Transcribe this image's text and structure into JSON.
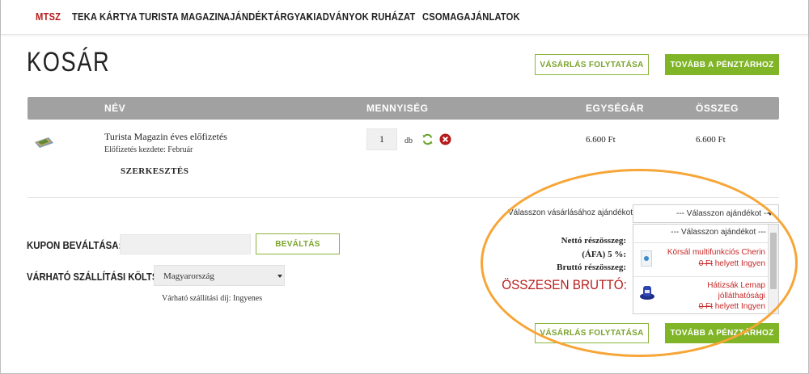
{
  "nav": {
    "items": [
      {
        "label": "MTSZ",
        "active": true
      },
      {
        "label": "TEKA KÁRTYA"
      },
      {
        "label": "TURISTA MAGAZIN"
      },
      {
        "label": "AJÁNDÉKTÁRGYAK"
      },
      {
        "label": "KIADVÁNYOK"
      },
      {
        "label": "RUHÁZAT"
      },
      {
        "label": "CSOMAGAJÁNLATOK"
      }
    ]
  },
  "page": {
    "title": "KOSÁR"
  },
  "actions": {
    "continue_label": "VÁSÁRLÁS FOLYTATÁSA",
    "checkout_label": "TOVÁBB A PÉNZTÁRHOZ"
  },
  "table": {
    "headers": {
      "name": "NÉV",
      "quantity": "MENNYISÉG",
      "unit_price": "EGYSÉGÁR",
      "total": "ÖSSZEG"
    },
    "rows": [
      {
        "name": "Turista Magazin éves előfizetés",
        "sub": "Előfizetés kezdete: Február",
        "edit": "SZERKESZTÉS",
        "quantity": "1",
        "unit": "db",
        "unit_price": "6.600 Ft",
        "total": "6.600 Ft"
      }
    ]
  },
  "coupon": {
    "label": "KUPON BEVÁLTÁSA:",
    "value": "",
    "button": "BEVÁLTÁS"
  },
  "shipping": {
    "label": "VÁRHATÓ SZÁLLÍTÁSI KÖLTSÉG",
    "country": "Magyarország",
    "fee_text": "Várható szállítási díj: Ingyenes"
  },
  "gift": {
    "prompt": "Válasszon vásárlásához ajándékot!",
    "select_value": "--- Válasszon ajándékot ---",
    "options": [
      {
        "label": "--- Válasszon ajándékot ---"
      },
      {
        "name": "Körsál multifunkciós Cherin",
        "old_price": "0 Ft",
        "suffix": "helyett Ingyen",
        "icon": "scarf-icon"
      },
      {
        "name": "Hátizsák Lemap jólláthatósági",
        "old_price": "0 Ft",
        "suffix": "helyett Ingyen",
        "icon": "backpack-icon"
      }
    ]
  },
  "summary": {
    "net_label": "Nettó részösszeg:",
    "vat_label": "(ÁFA) 5 %:",
    "gross_label": "Bruttó részösszeg:",
    "total_label": "ÖSSZESEN BRUTTÓ:"
  },
  "colors": {
    "accent_green": "#7fb526",
    "accent_red": "#b71c1c",
    "annotation_orange": "#f7a536",
    "header_gray": "#a1a1a1"
  }
}
